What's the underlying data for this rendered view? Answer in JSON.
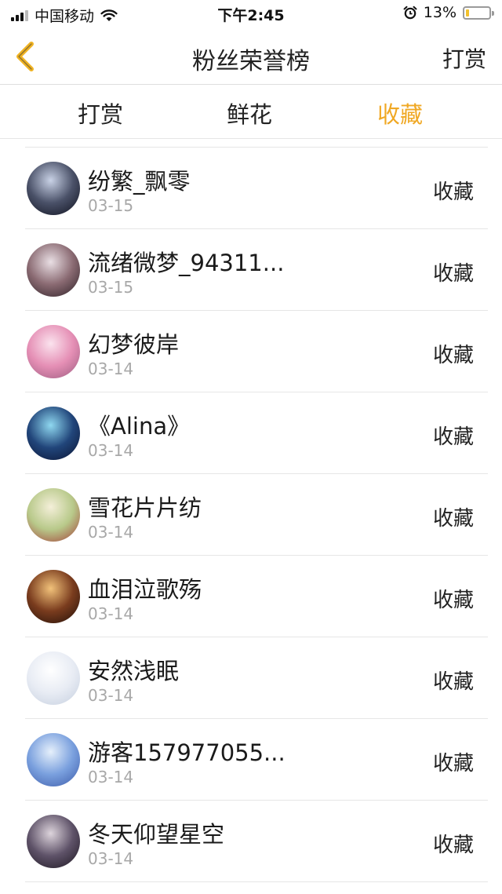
{
  "status_bar": {
    "carrier": "中国移动",
    "time": "下午2:45",
    "battery_percent": "13%",
    "battery_level": 0.13,
    "battery_color": "#f2c12e",
    "icons": [
      "signal-icon",
      "wifi-icon",
      "alarm-icon",
      "battery-icon"
    ]
  },
  "nav": {
    "title": "粉丝荣誉榜",
    "action_label": "打赏",
    "back_icon": "chevron-left-icon",
    "accent": "#f0b322"
  },
  "tabs": [
    {
      "label": "打赏",
      "active": false
    },
    {
      "label": "鲜花",
      "active": false
    },
    {
      "label": "收藏",
      "active": true
    }
  ],
  "active_color": "#f0a824",
  "list": {
    "items": [
      {
        "name": "纷繁_飘零",
        "date": "03-15",
        "action": "收藏",
        "avatar_colors": [
          "#c9d2e6",
          "#4a5168",
          "#0d0f1c"
        ]
      },
      {
        "name": "流绪微梦_94311...",
        "date": "03-15",
        "action": "收藏",
        "avatar_colors": [
          "#e9dfe4",
          "#8a6a72",
          "#2a1e24"
        ]
      },
      {
        "name": "幻梦彼岸",
        "date": "03-14",
        "action": "收藏",
        "avatar_colors": [
          "#fbe3ee",
          "#e58fb5",
          "#9a5a7e"
        ]
      },
      {
        "name": "《Alina》",
        "date": "03-14",
        "action": "收藏",
        "avatar_colors": [
          "#8fd8f0",
          "#21457a",
          "#0a1230"
        ]
      },
      {
        "name": "雪花片片纺",
        "date": "03-14",
        "action": "收藏",
        "avatar_colors": [
          "#f4efd9",
          "#b8c98a",
          "#a33a35"
        ]
      },
      {
        "name": "血泪泣歌殇",
        "date": "03-14",
        "action": "收藏",
        "avatar_colors": [
          "#f2c27a",
          "#7a3c1e",
          "#1e0e08"
        ]
      },
      {
        "name": "安然浅眠",
        "date": "03-14",
        "action": "收藏",
        "avatar_colors": [
          "#ffffff",
          "#e8ecf4",
          "#c4cede"
        ]
      },
      {
        "name": "游客157977055...",
        "date": "03-14",
        "action": "收藏",
        "avatar_colors": [
          "#e6f0fb",
          "#7aa0de",
          "#3b5aa8"
        ]
      },
      {
        "name": "冬天仰望星空",
        "date": "03-14",
        "action": "收藏",
        "avatar_colors": [
          "#ddd4dc",
          "#5e5268",
          "#1c1620"
        ]
      }
    ]
  }
}
